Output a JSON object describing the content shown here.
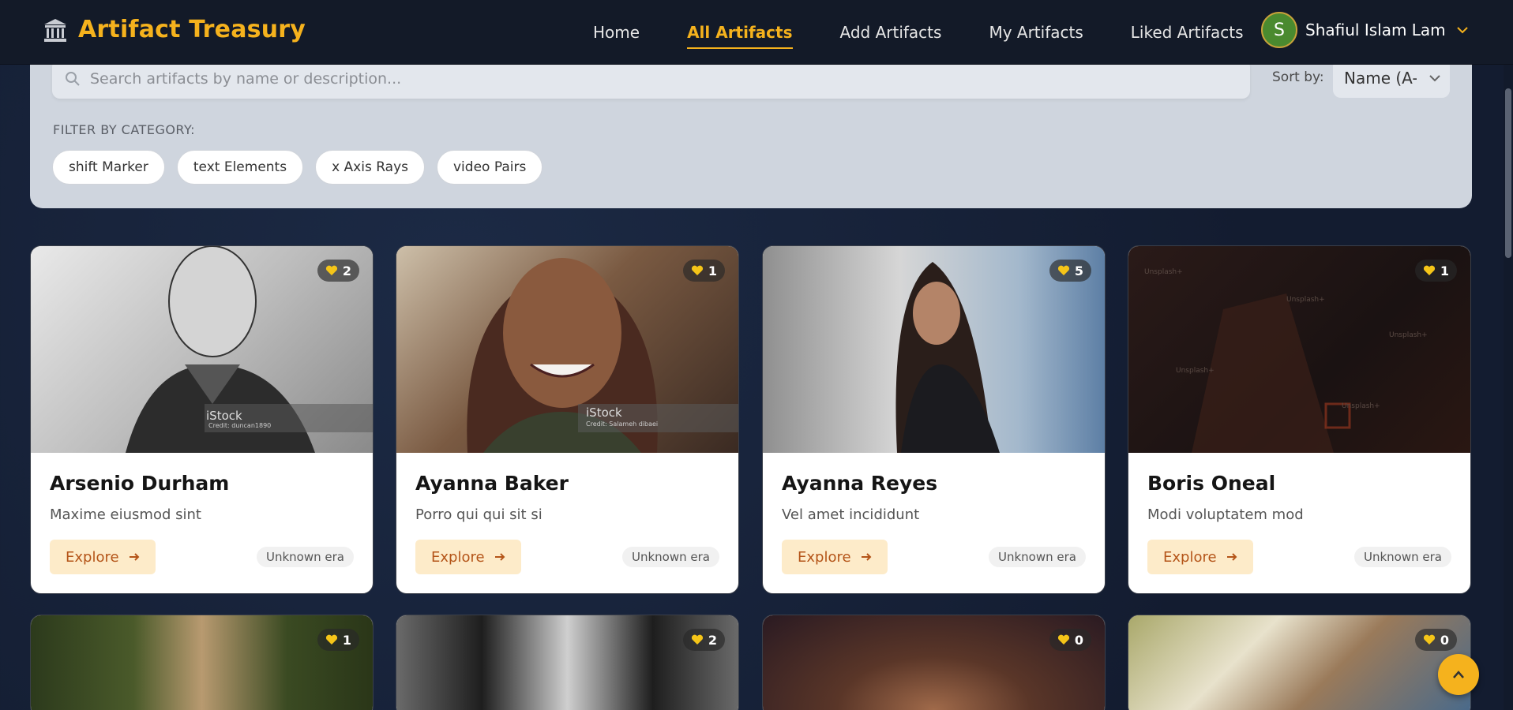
{
  "brand": {
    "name": "Artifact Treasury",
    "accent": "#f5b21d"
  },
  "nav": {
    "links": [
      {
        "label": "Home"
      },
      {
        "label": "All Artifacts"
      },
      {
        "label": "Add Artifacts"
      },
      {
        "label": "My Artifacts"
      },
      {
        "label": "Liked Artifacts"
      }
    ],
    "active_index": 1
  },
  "user": {
    "initial": "S",
    "name": "Shafiul Islam Lam"
  },
  "search": {
    "placeholder": "Search artifacts by name or description..."
  },
  "sort": {
    "label": "Sort by:",
    "value": "Name (A-"
  },
  "filter": {
    "label": "FILTER BY CATEGORY:",
    "chips": [
      "shift Marker",
      "text Elements",
      "x Axis Rays",
      "video Pairs"
    ]
  },
  "cards": [
    {
      "title": "Arsenio Durham",
      "desc": "Maxime eiusmod sint",
      "likes": "2",
      "era": "Unknown era",
      "explore": "Explore",
      "watermark": "iStock",
      "credit": "Credit: duncan1890"
    },
    {
      "title": "Ayanna Baker",
      "desc": "Porro qui qui sit si",
      "likes": "1",
      "era": "Unknown era",
      "explore": "Explore",
      "watermark": "iStock",
      "credit": "Credit: Salameh dibaei"
    },
    {
      "title": "Ayanna Reyes",
      "desc": "Vel amet incididunt",
      "likes": "5",
      "era": "Unknown era",
      "explore": "Explore"
    },
    {
      "title": "Boris Oneal",
      "desc": "Modi voluptatem mod",
      "likes": "1",
      "era": "Unknown era",
      "explore": "Explore",
      "watermark": "Unsplash+"
    },
    {
      "likes": "1"
    },
    {
      "likes": "2"
    },
    {
      "likes": "0"
    },
    {
      "likes": "0"
    }
  ]
}
